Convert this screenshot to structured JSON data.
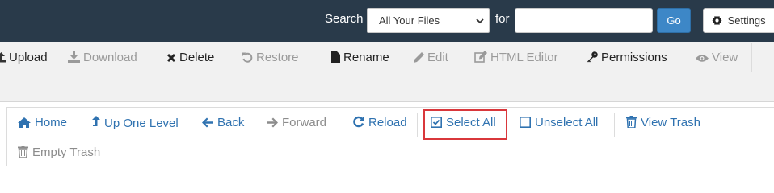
{
  "search": {
    "label": "Search",
    "scope_value": "All Your Files",
    "for_label": "for",
    "query_value": "",
    "go_label": "Go",
    "settings_label": "Settings"
  },
  "toolbar": {
    "upload": "Upload",
    "download": "Download",
    "delete": "Delete",
    "restore": "Restore",
    "rename": "Rename",
    "edit": "Edit",
    "html_editor": "HTML Editor",
    "permissions": "Permissions",
    "view": "View"
  },
  "nav": {
    "home": "Home",
    "up_one_level": "Up One Level",
    "back": "Back",
    "forward": "Forward",
    "reload": "Reload",
    "select_all": "Select All",
    "unselect_all": "Unselect All",
    "view_trash": "View Trash",
    "empty_trash": "Empty Trash"
  },
  "colors": {
    "topbar": "#293a4a",
    "link_blue": "#2f72b0",
    "go_button": "#3d87c7",
    "highlight": "#d9373b"
  },
  "icons": {
    "upload": "upload-icon",
    "download": "download-icon",
    "delete": "x-icon",
    "restore": "undo-icon",
    "rename": "file-icon",
    "edit": "pencil-icon",
    "html_editor": "edit-square-icon",
    "permissions": "key-icon",
    "view": "eye-icon",
    "home": "home-icon",
    "up": "up-arrow-icon",
    "back": "left-arrow-icon",
    "forward": "right-arrow-icon",
    "reload": "reload-icon",
    "select_all": "checked-box-icon",
    "unselect_all": "empty-box-icon",
    "trash": "trash-icon",
    "settings": "gear-icon"
  }
}
